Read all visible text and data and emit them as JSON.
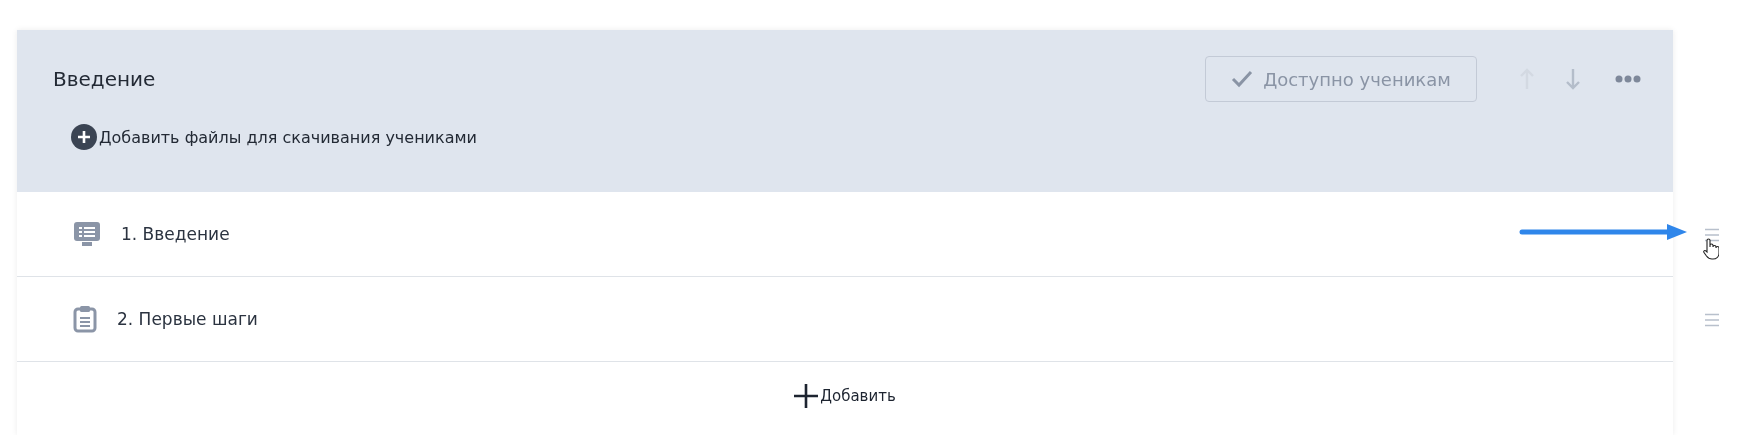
{
  "module": {
    "title": "Введение",
    "publish_button": {
      "label": "Доступно ученикам"
    },
    "move_up": {
      "disabled": true
    },
    "move_down": {
      "disabled": false
    },
    "add_files": {
      "label": "Добавить файлы для скачивания учениками"
    }
  },
  "lessons": [
    {
      "kind": "lesson",
      "title": "1. Введение",
      "pointed": true
    },
    {
      "kind": "task",
      "title": "2. Первые шаги",
      "pointed": false
    }
  ],
  "add_button": {
    "label": "Добавить"
  }
}
